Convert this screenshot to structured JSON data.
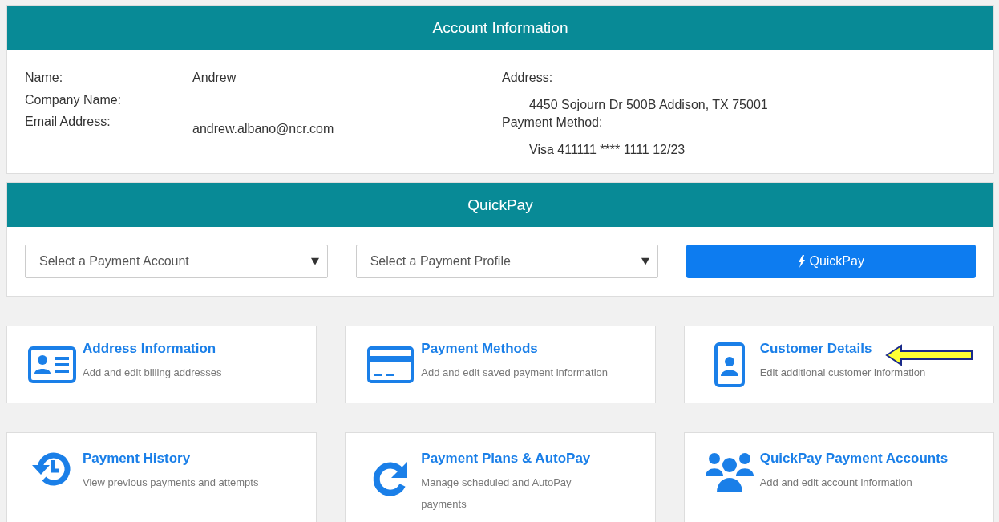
{
  "account": {
    "title": "Account Information",
    "left": [
      {
        "label": "Name:",
        "value": "Andrew"
      },
      {
        "label": "Company Name:"
      },
      {
        "label": "Email Address:",
        "value": "andrew.albano@ncr.com"
      }
    ],
    "right": [
      {
        "label": "Address:",
        "value": "4450 Sojourn Dr 500B Addison, TX 75001"
      },
      {
        "label": "Payment Method:",
        "value": "Visa 411111 **** 1111 12/23"
      }
    ]
  },
  "quickpay": {
    "title": "QuickPay",
    "account_select": {
      "placeholder": "Select a Payment Account"
    },
    "profile_select": {
      "placeholder": "Select a Payment Profile"
    },
    "button": "QuickPay"
  },
  "tiles": [
    {
      "title": "Address Information",
      "description": "Add and edit billing addresses",
      "arrow": false
    },
    {
      "title": "Payment Methods",
      "description": "Add and edit saved payment information",
      "arrow": false
    },
    {
      "title": "Customer Details",
      "description": "Edit additional customer information",
      "arrow": true
    },
    {
      "title": "Payment History",
      "description": "View previous payments and attempts",
      "arrow": false
    },
    {
      "title": "Payment Plans & AutoPay",
      "description": "Manage scheduled and AutoPay payments",
      "arrow": false
    },
    {
      "title": "QuickPay Payment Accounts",
      "description": "Add and edit account information",
      "arrow": false
    }
  ]
}
